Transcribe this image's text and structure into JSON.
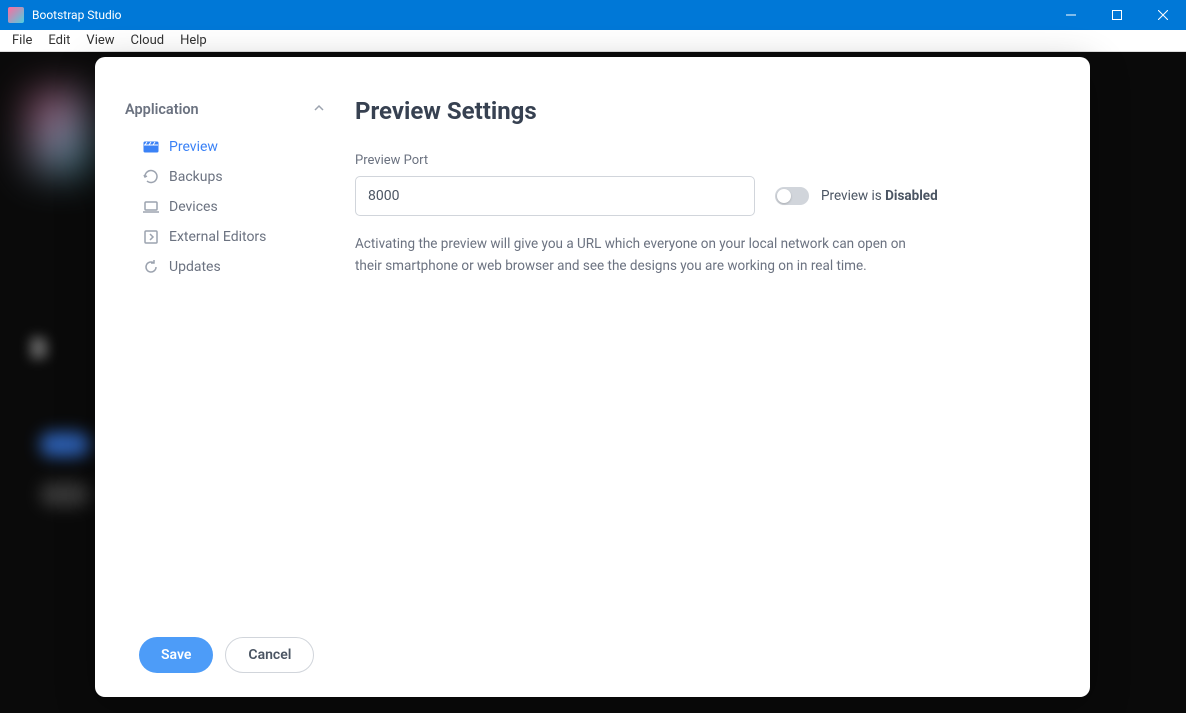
{
  "window": {
    "title": "Bootstrap Studio"
  },
  "menubar": {
    "items": [
      "File",
      "Edit",
      "View",
      "Cloud",
      "Help"
    ]
  },
  "sidebar": {
    "section_title": "Application",
    "items": [
      {
        "label": "Preview",
        "icon": "clapper"
      },
      {
        "label": "Backups",
        "icon": "restore"
      },
      {
        "label": "Devices",
        "icon": "laptop"
      },
      {
        "label": "External Editors",
        "icon": "external"
      },
      {
        "label": "Updates",
        "icon": "refresh"
      }
    ]
  },
  "content": {
    "title": "Preview Settings",
    "port_label": "Preview Port",
    "port_value": "8000",
    "toggle_text_prefix": "Preview is ",
    "toggle_text_state": "Disabled",
    "help_text": "Activating the preview will give you a URL which everyone on your local network can open on their smartphone or web browser and see the designs you are working on in real time."
  },
  "footer": {
    "save": "Save",
    "cancel": "Cancel"
  }
}
